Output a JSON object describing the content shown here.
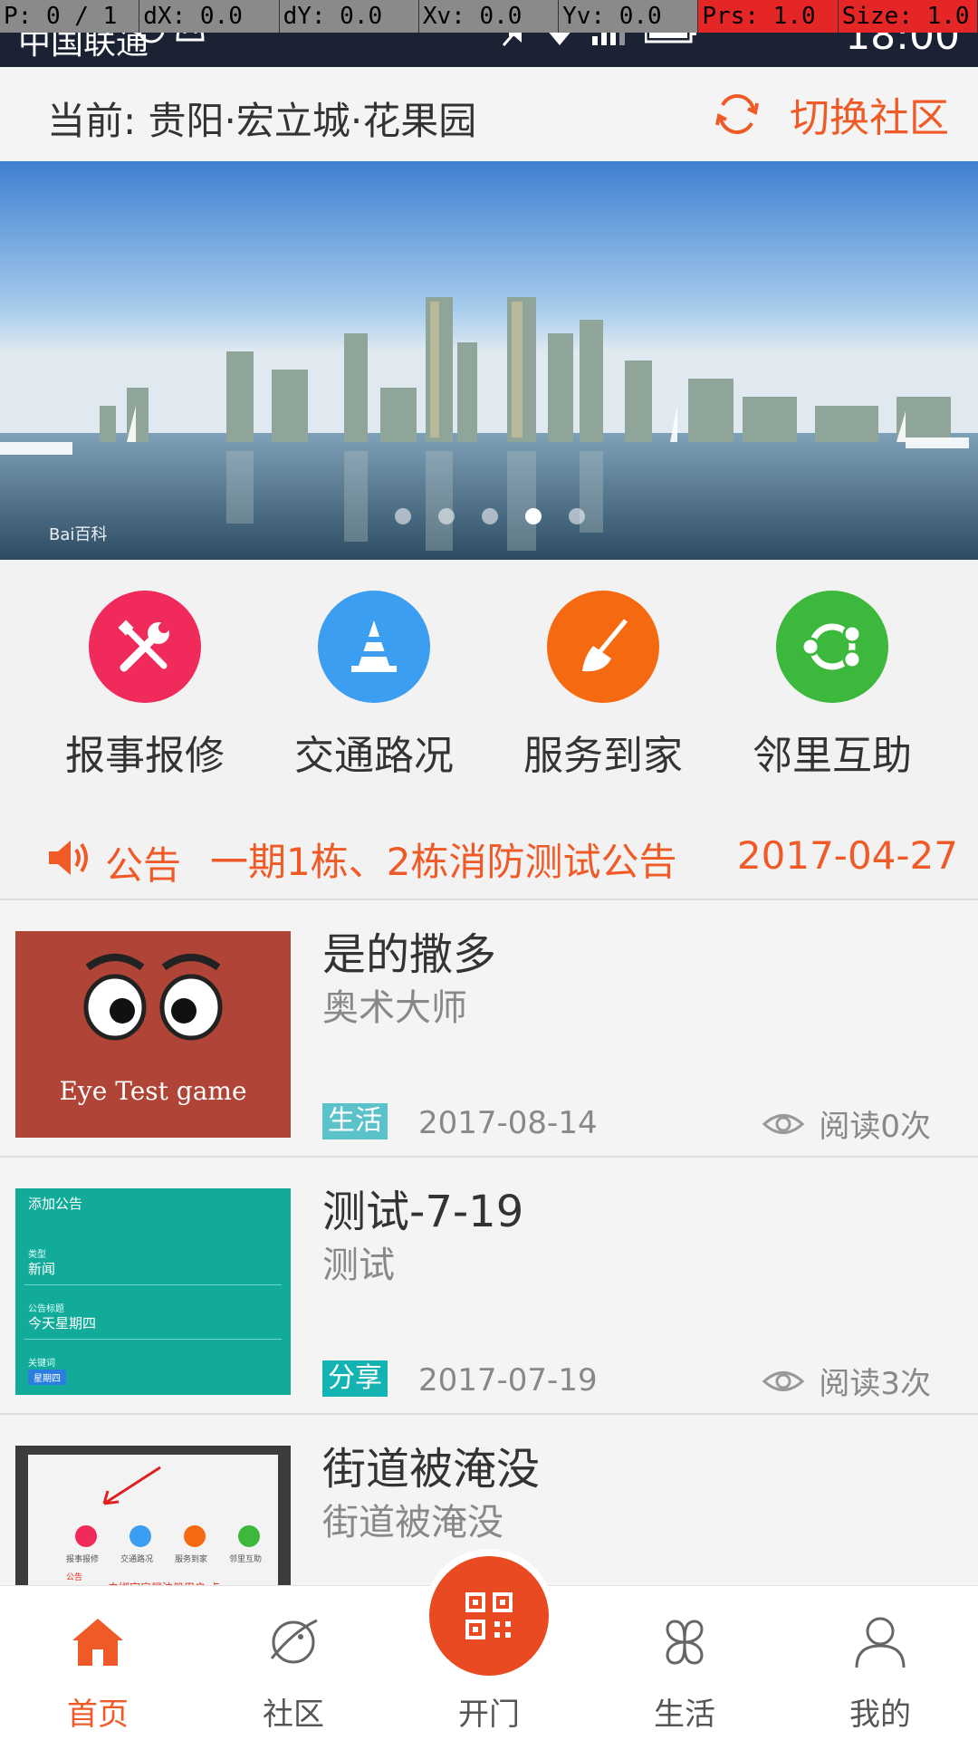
{
  "debug": [
    "P: 0 / 1",
    "dX: 0.0",
    "dY: 0.0",
    "Xv: 0.0",
    "Yv: 0.0",
    "Prs: 1.0",
    "Size: 1.0"
  ],
  "status": {
    "carrier": "中国联通",
    "time": "18:00"
  },
  "header": {
    "current_label": "当前: 贵阳·宏立城·花果园",
    "switch_label": "切换社区"
  },
  "banner": {
    "watermark": "Bai百科",
    "page_count": 5,
    "active_index": 3
  },
  "quick_menu": [
    {
      "label": "报事报修",
      "icon": "wrench-screwdriver-icon",
      "color": "#f02a5a"
    },
    {
      "label": "交通路况",
      "icon": "traffic-cone-icon",
      "color": "#3c9ef0"
    },
    {
      "label": "服务到家",
      "icon": "broom-icon",
      "color": "#f56a10"
    },
    {
      "label": "邻里互助",
      "icon": "ubuntu-logo-icon",
      "color": "#3cb83c"
    }
  ],
  "notice": {
    "tag": "公告",
    "text": "一期1栋、2栋消防测试公告",
    "date": "2017-04-27"
  },
  "articles": [
    {
      "title": "是的撒多",
      "subtitle": "奥术大师",
      "category": "生活",
      "category_color": "#5bc2c9",
      "date": "2017-08-14",
      "reads": "阅读0次",
      "thumb_text": "Eye Test game"
    },
    {
      "title": "测试-7-19",
      "subtitle": "测试",
      "category": "分享",
      "category_color": "#12b3b1",
      "date": "2017-07-19",
      "reads": "阅读3次",
      "thumb": {
        "heading": "添加公告",
        "f1_label": "类型",
        "f1_value": "新闻",
        "f2_label": "公告标题",
        "f2_value": "今天星期四",
        "f3_label": "关键词",
        "chip": "星期四"
      }
    },
    {
      "title": "街道被淹没",
      "subtitle": "街道被淹没",
      "category": "",
      "date": "",
      "reads": "",
      "thumb": {
        "labels": [
          "报事报修",
          "交通路况",
          "服务到家",
          "邻里互助"
        ],
        "notice_tag": "公告",
        "notice_text": "未绑定房屋注册用户,点"
      }
    }
  ],
  "nav": {
    "home": "首页",
    "community": "社区",
    "open_door": "开门",
    "life": "生活",
    "mine": "我的",
    "active": "首页"
  },
  "colors": {
    "accent": "#ef5a27"
  }
}
